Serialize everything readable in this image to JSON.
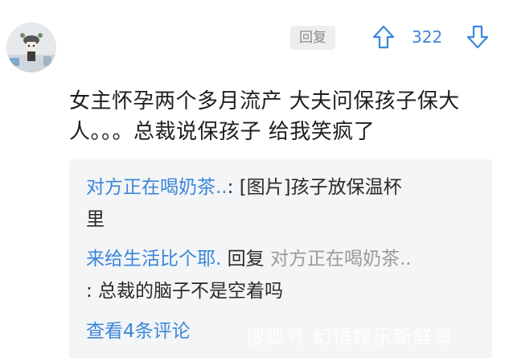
{
  "comment": {
    "reply_label": "回复",
    "vote_count": "322",
    "text_line1": "女主怀孕两个多月流产  大夫问保孩子保大",
    "text_line2": "人。。。总裁说保孩子  给我笑疯了"
  },
  "replies": [
    {
      "user": "对方正在喝奶茶..",
      "sep": ": ",
      "text_line1": "[图片]孩子放保温杯",
      "text_line2": "里"
    },
    {
      "user": "来给生活比个耶.",
      "reply_word": " 回复 ",
      "target": "对方正在喝奶茶..",
      "text_line2": ":  总裁的脑子不是空着吗"
    }
  ],
  "view_more": "查看4条评论",
  "watermark": "搜狐号 幻悟娱乐新鲜事",
  "colors": {
    "link": "#3b86d9",
    "text": "#1e1e1e",
    "muted": "#9a9a9a",
    "reply_bg": "#f4f5f7"
  },
  "icons": {
    "upvote": "arrow-up-outline-icon",
    "downvote": "arrow-down-outline-icon"
  }
}
